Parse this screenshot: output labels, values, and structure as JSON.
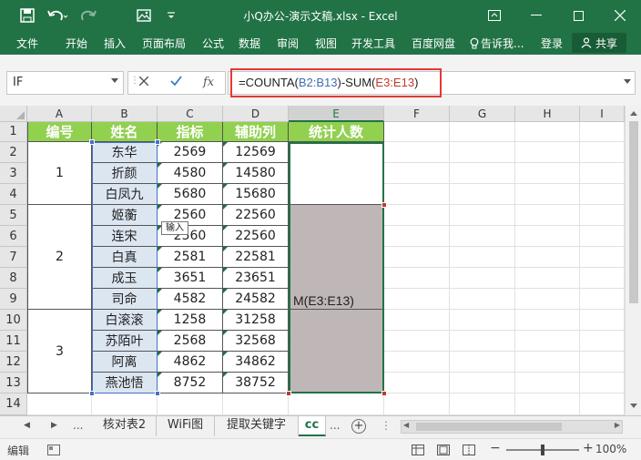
{
  "window": {
    "title": "小Q办公-演示文稿.xlsx - Excel"
  },
  "ribbon": {
    "tabs": [
      "文件",
      "开始",
      "插入",
      "页面布局",
      "公式",
      "数据",
      "审阅",
      "视图",
      "开发工具",
      "百度网盘"
    ],
    "tell_me": "告诉我...",
    "login": "登录",
    "share": "共享"
  },
  "formula_bar": {
    "name_box": "IF",
    "formula_parts": [
      {
        "text": "=COUNTA(",
        "color": "#222222"
      },
      {
        "text": "B2:B13",
        "color": "#3f6fb5"
      },
      {
        "text": ")-SUM(",
        "color": "#222222"
      },
      {
        "text": "E3:E13",
        "color": "#c0392b"
      },
      {
        "text": ")",
        "color": "#222222"
      }
    ]
  },
  "grid": {
    "columns": [
      "A",
      "B",
      "C",
      "D",
      "E",
      "F",
      "G",
      "H",
      "I"
    ],
    "rows": [
      "1",
      "2",
      "3",
      "4",
      "5",
      "6",
      "7",
      "8",
      "9",
      "10",
      "11",
      "12",
      "13",
      "14"
    ],
    "headers": [
      "编号",
      "姓名",
      "指标",
      "辅助列",
      "统计人数"
    ],
    "groups": [
      "1",
      "2",
      "3"
    ],
    "names": [
      "东华",
      "折颜",
      "白凤九",
      "姬蘅",
      "连宋",
      "白真",
      "成玉",
      "司命",
      "白滚滚",
      "苏陌叶",
      "阿离",
      "燕池悟"
    ],
    "c_values": [
      "2569",
      "4580",
      "5680",
      "2560",
      "2560",
      "2581",
      "3651",
      "4582",
      "1258",
      "2568",
      "4862",
      "8752"
    ],
    "d_values": [
      "12569",
      "14580",
      "15680",
      "22560",
      "22560",
      "22581",
      "23651",
      "24582",
      "31258",
      "32568",
      "34862",
      "38752"
    ],
    "e4_text": "M(E3:E13)",
    "tooltip": "输入",
    "colors": {
      "header_green": "#92d050",
      "name_fill": "#dce6f1",
      "grey_fill": "#bfb7b7",
      "excel_green": "#217346"
    }
  },
  "sheets": {
    "nav_more": "...",
    "tabs": [
      "核对表2",
      "WiFi图",
      "提取关键字",
      "cc"
    ],
    "more": "..."
  },
  "status": {
    "mode": "编辑",
    "zoom": "100%"
  }
}
